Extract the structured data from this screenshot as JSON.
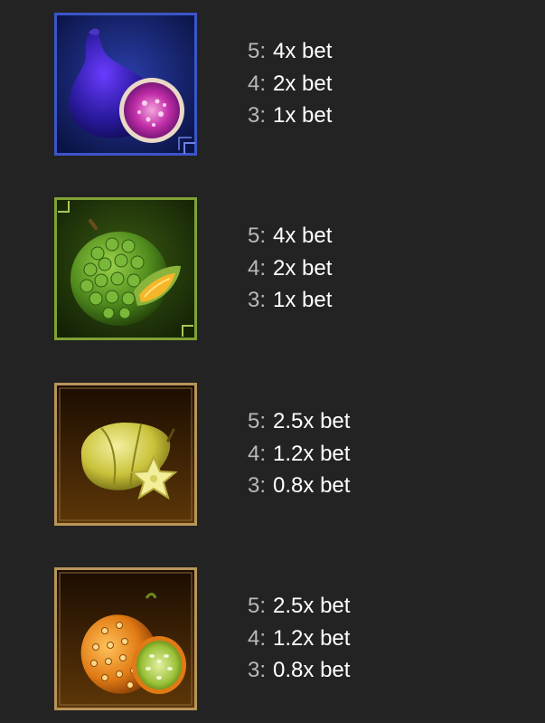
{
  "paytable": [
    {
      "symbol": {
        "icon": "fig-icon",
        "frame_color": "#3b55c9",
        "bg_color": "#12205e"
      },
      "pays": [
        {
          "count": "5",
          "value": "4x bet"
        },
        {
          "count": "4",
          "value": "2x bet"
        },
        {
          "count": "3",
          "value": "1x bet"
        }
      ]
    },
    {
      "symbol": {
        "icon": "durian-icon",
        "frame_color": "#7fa234",
        "bg_color": "#1e3208"
      },
      "pays": [
        {
          "count": "5",
          "value": "4x bet"
        },
        {
          "count": "4",
          "value": "2x bet"
        },
        {
          "count": "3",
          "value": "1x bet"
        }
      ]
    },
    {
      "symbol": {
        "icon": "starfruit-icon",
        "frame_color": "#b8955a",
        "bg_color": "#2b1603"
      },
      "pays": [
        {
          "count": "5",
          "value": "2.5x bet"
        },
        {
          "count": "4",
          "value": "1.2x bet"
        },
        {
          "count": "3",
          "value": "0.8x bet"
        }
      ]
    },
    {
      "symbol": {
        "icon": "kiwano-icon",
        "frame_color": "#b8955a",
        "bg_color": "#2b1603"
      },
      "pays": [
        {
          "count": "5",
          "value": "2.5x bet"
        },
        {
          "count": "4",
          "value": "1.2x bet"
        },
        {
          "count": "3",
          "value": "0.8x bet"
        }
      ]
    }
  ]
}
